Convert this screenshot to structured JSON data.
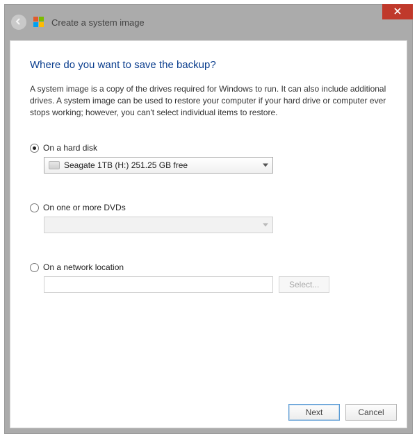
{
  "window": {
    "title": "Create a system image"
  },
  "main": {
    "heading": "Where do you want to save the backup?",
    "description": "A system image is a copy of the drives required for Windows to run. It can also include additional drives. A system image can be used to restore your computer if your hard drive or computer ever stops working; however, you can't select individual items to restore."
  },
  "options": {
    "hard_disk": {
      "label": "On a hard disk",
      "selected_drive": "Seagate 1TB (H:)  251.25 GB free"
    },
    "dvd": {
      "label": "On one or more DVDs"
    },
    "network": {
      "label": "On a network location",
      "select_btn": "Select..."
    }
  },
  "footer": {
    "next": "Next",
    "cancel": "Cancel"
  }
}
